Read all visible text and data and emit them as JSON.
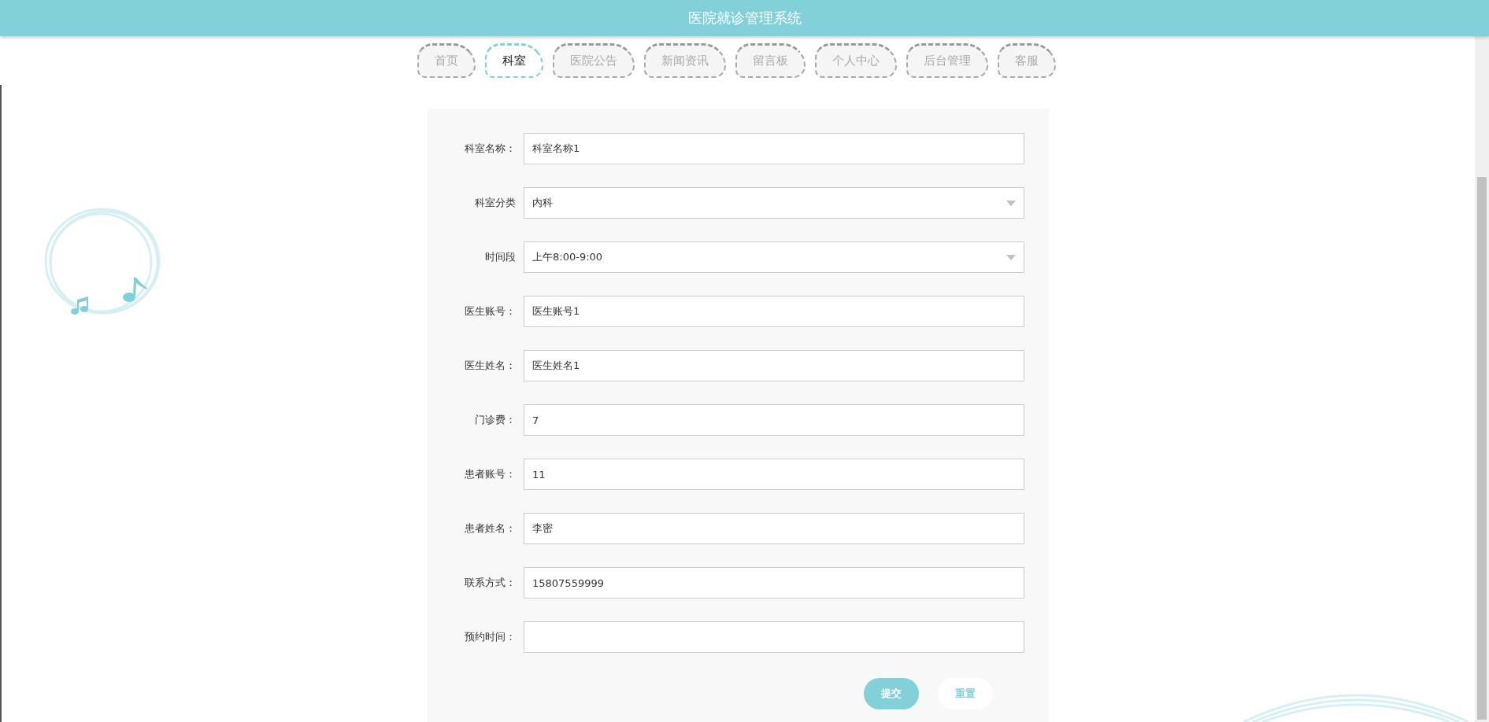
{
  "header": {
    "title": "医院就诊管理系统"
  },
  "tabs": [
    {
      "label": "首页",
      "selected": false
    },
    {
      "label": "科室",
      "selected": true
    },
    {
      "label": "医院公告",
      "selected": false
    },
    {
      "label": "新闻资讯",
      "selected": false
    },
    {
      "label": "留言板",
      "selected": false
    },
    {
      "label": "个人中心",
      "selected": false
    },
    {
      "label": "后台管理",
      "selected": false
    },
    {
      "label": "客服",
      "selected": false
    }
  ],
  "form": {
    "fields": [
      {
        "label": "科室名称：",
        "kind": "input",
        "value": "科室名称1"
      },
      {
        "label": "科室分类",
        "kind": "select",
        "value": "内科"
      },
      {
        "label": "时间段",
        "kind": "select",
        "value": "上午8:00-9:00"
      },
      {
        "label": "医生账号：",
        "kind": "input",
        "value": "医生账号1"
      },
      {
        "label": "医生姓名：",
        "kind": "input",
        "value": "医生姓名1"
      },
      {
        "label": "门诊费：",
        "kind": "input",
        "value": "7"
      },
      {
        "label": "患者账号：",
        "kind": "input",
        "value": "11"
      },
      {
        "label": "患者姓名：",
        "kind": "input",
        "value": "李密"
      },
      {
        "label": "联系方式：",
        "kind": "input",
        "value": "15807559999"
      },
      {
        "label": "预约时间：",
        "kind": "input"
      }
    ],
    "buttons": [
      {
        "label": "提交",
        "kind": "primary"
      },
      {
        "label": "重置",
        "kind": "secondary"
      }
    ]
  }
}
